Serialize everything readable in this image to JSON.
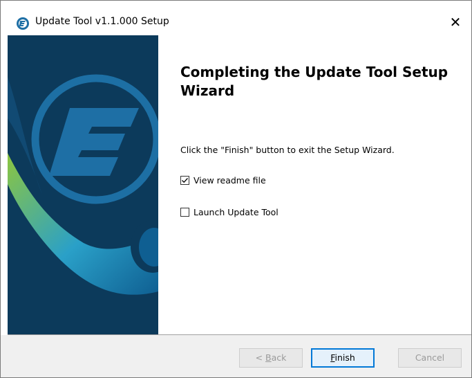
{
  "window": {
    "title": "Update Tool v1.1.000 Setup",
    "close_glyph": "✕",
    "icon": "update-tool-app-icon"
  },
  "content": {
    "heading": "Completing the Update Tool Setup Wizard",
    "info": "Click the \"Finish\" button to exit the Setup Wizard.",
    "options": [
      {
        "label": "View readme file",
        "checked": true
      },
      {
        "label": "Launch Update Tool",
        "checked": false
      }
    ]
  },
  "buttons": {
    "back": {
      "prefix": "< ",
      "mnemonic": "B",
      "rest": "ack",
      "enabled": false
    },
    "finish": {
      "mnemonic": "F",
      "rest": "inish",
      "enabled": true,
      "default": true
    },
    "cancel": {
      "label": "Cancel",
      "enabled": false
    }
  },
  "colors": {
    "banner_bg": "#0c3a5b",
    "banner_logo": "#1e6fa5",
    "accent_focus": "#0078d7",
    "swoosh_green": "#8dc63f",
    "swoosh_blue": "#1a88c9"
  }
}
